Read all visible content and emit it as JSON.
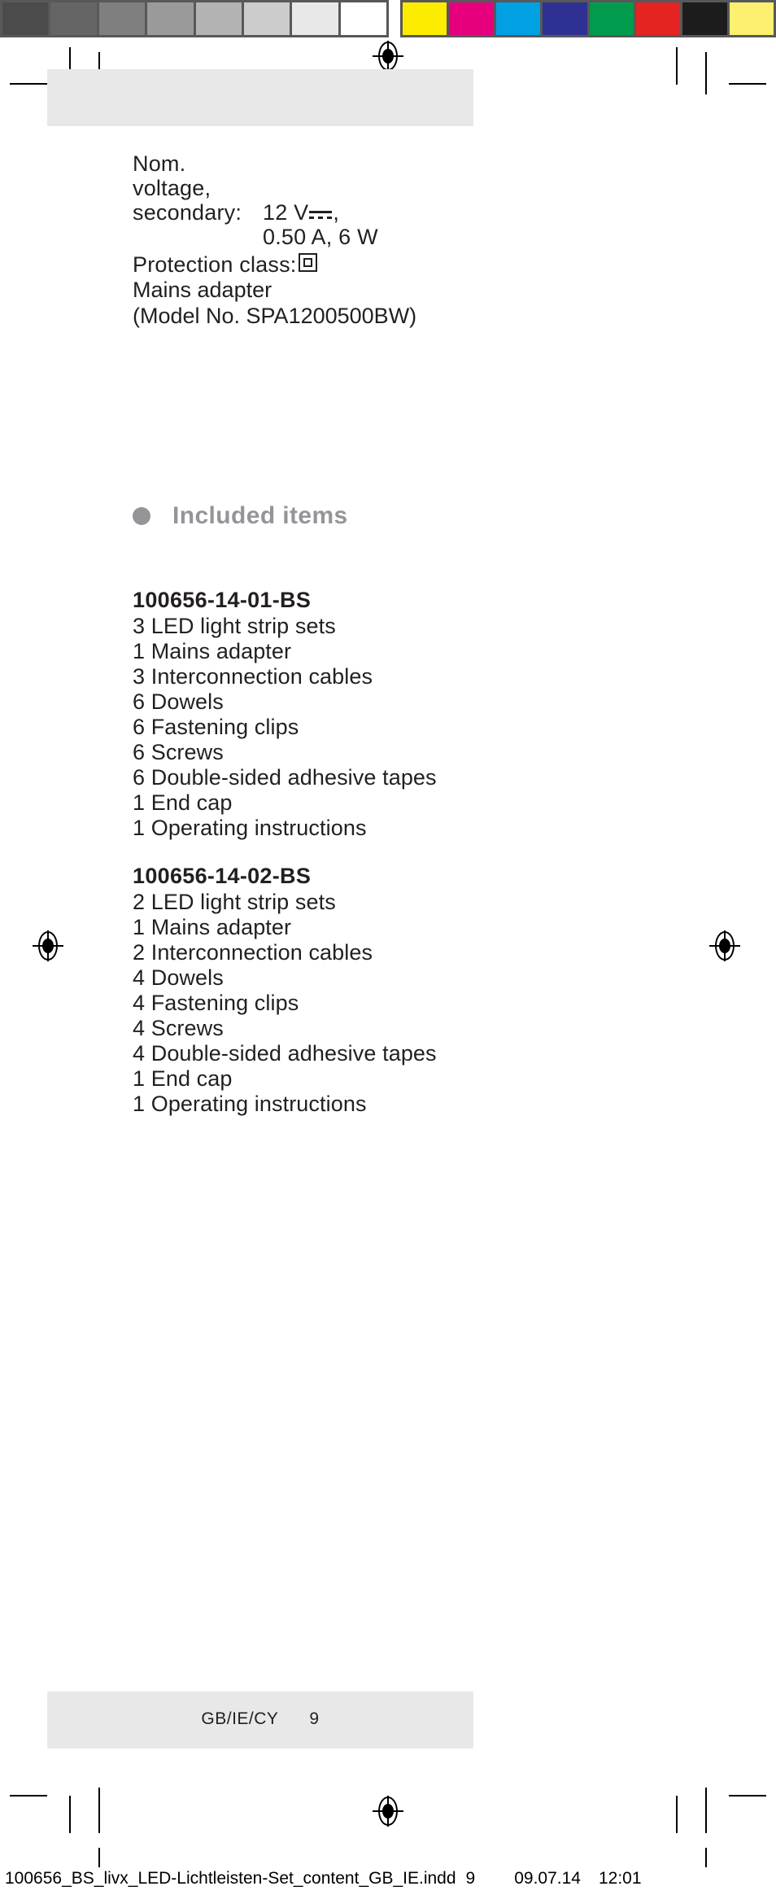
{
  "document": {
    "type": "print-proof-page",
    "page_number": "9",
    "language_code": "GB/IE/CY"
  },
  "calibration": {
    "gray_bar_label": "grayscale-calibration-bar",
    "color_bar_label": "color-calibration-bar",
    "gray_swatches": [
      "#4b4b4b",
      "#656565",
      "#7f7f7f",
      "#9a9a9a",
      "#b3b3b3",
      "#cccccc",
      "#e8e8e8",
      "#ffffff"
    ],
    "color_swatches": [
      "#fced00",
      "#e6007e",
      "#00a0e3",
      "#2e3192",
      "#009b4c",
      "#e52421",
      "#1c1c1c",
      "#fbf06f"
    ],
    "frame_color": "#58585a"
  },
  "specs": {
    "rows": [
      {
        "label_line1": "Nom. voltage,",
        "label_line2": "secondary:",
        "value_line1": "12 V",
        "value_line1_suffix": ",",
        "value_line2": "0.50 A, 6 W",
        "symbol": "dc-voltage-symbol"
      },
      {
        "label": "Protection class:",
        "symbol": "protection-class-II-symbol"
      }
    ],
    "adapter_line": "Mains adapter",
    "adapter_model": "(Model No. SPA1200500BW)"
  },
  "section": {
    "bullet_color": "#939598",
    "heading": "Included items",
    "heading_color": "#939598"
  },
  "included_items": [
    {
      "sku": "100656-14-01-BS",
      "items": [
        "3 LED light strip sets",
        "1 Mains adapter",
        "3 Interconnection cables",
        "6 Dowels",
        "6 Fastening clips",
        "6 Screws",
        "6 Double-sided adhesive tapes",
        "1 End cap",
        "1 Operating instructions"
      ]
    },
    {
      "sku": "100656-14-02-BS",
      "items": [
        "2 LED light strip sets",
        "1 Mains adapter",
        "2 Interconnection cables",
        "4 Dowels",
        "4 Fastening clips",
        "4 Screws",
        "4 Double-sided adhesive tapes",
        "1 End cap",
        "1 Operating instructions"
      ]
    }
  ],
  "footer": {
    "language": "GB/IE/CY",
    "page": "9"
  },
  "slug": {
    "filename": "100656_BS_livx_LED-Lichtleisten-Set_content_GB_IE.indd",
    "page": "9",
    "date": "09.07.14",
    "time": "12:01"
  }
}
